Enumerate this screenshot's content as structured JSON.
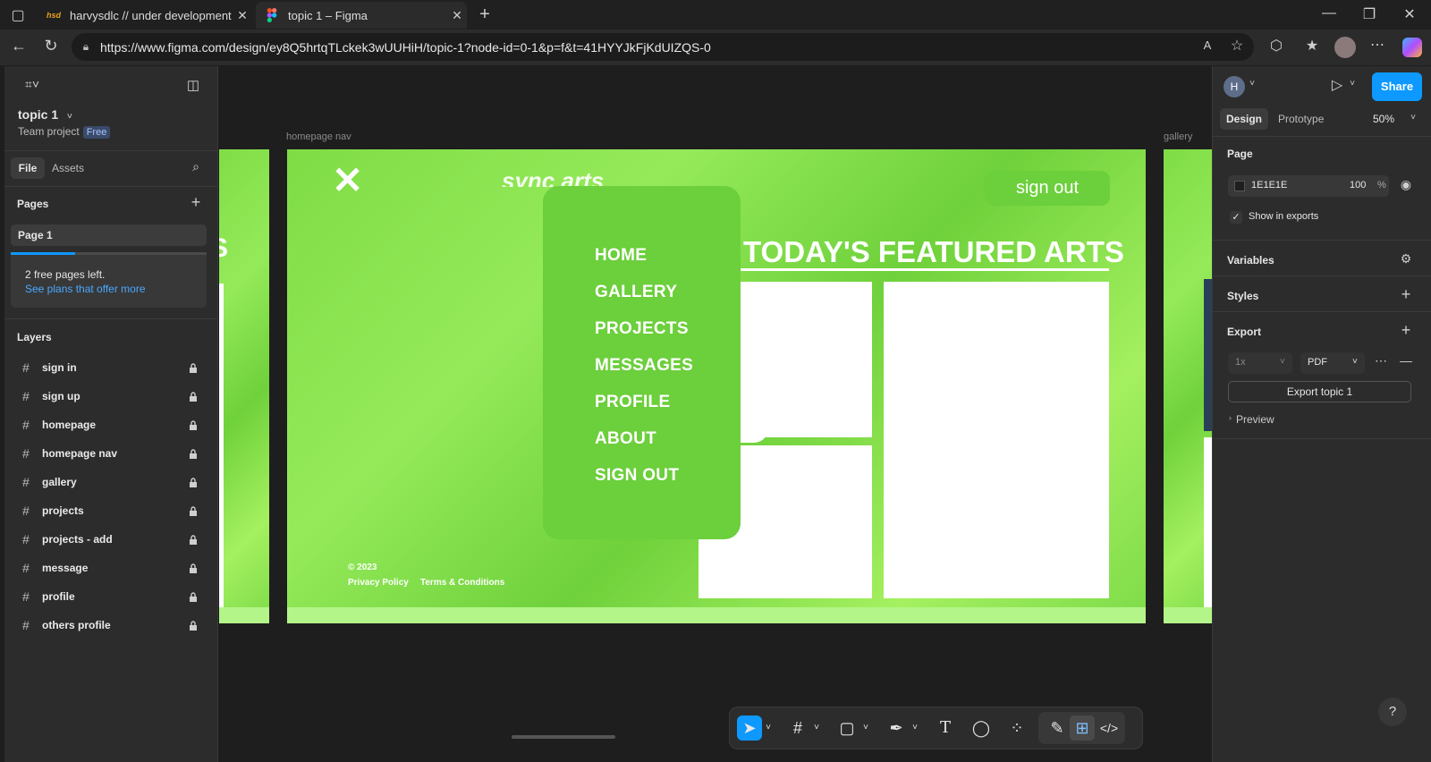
{
  "browser": {
    "tabs": [
      {
        "title": "harvysdlc // under development",
        "favicon": "hsd"
      },
      {
        "title": "topic 1 – Figma",
        "favicon": "figma-icon"
      }
    ],
    "url": "https://www.figma.com/design/ey8Q5hrtqTLckek3wUUHiH/topic-1?node-id=0-1&p=f&t=41HYYJkFjKdUIZQS-0"
  },
  "figma": {
    "file_name": "topic 1",
    "project": "Team project",
    "plan_badge": "Free",
    "tabs": {
      "file": "File",
      "assets": "Assets"
    },
    "pages_header": "Pages",
    "page": "Page 1",
    "free_pages_notice": "2 free pages left.",
    "plans_link": "See plans that offer more",
    "layers_header": "Layers",
    "layers": [
      "sign in",
      "sign up",
      "homepage",
      "homepage nav",
      "gallery",
      "projects",
      "projects - add",
      "message",
      "profile",
      "others profile"
    ]
  },
  "canvas": {
    "frame_label_main": "homepage nav",
    "frame_label_right": "gallery",
    "partial_left_text": "S",
    "logo_text": "sync arts",
    "signout_btn": "sign out",
    "featured_title": "TODAY'S FEATURED ARTS",
    "menu_items": [
      "HOME",
      "GALLERY",
      "PROJECTS",
      "MESSAGES",
      "PROFILE",
      "ABOUT",
      "SIGN OUT"
    ],
    "copyright": "© 2023",
    "privacy": "Privacy Policy",
    "terms": "Terms & Conditions"
  },
  "right_panel": {
    "avatar": "H",
    "share": "Share",
    "tab_design": "Design",
    "tab_prototype": "Prototype",
    "zoom": "50%",
    "page_header": "Page",
    "page_color": "1E1E1E",
    "page_opacity": "100",
    "percent": "%",
    "show_in_exports": "Show in exports",
    "variables": "Variables",
    "styles": "Styles",
    "export": "Export",
    "export_scale": "1x",
    "export_format": "PDF",
    "export_button": "Export topic 1",
    "preview": "Preview"
  },
  "colors": {
    "accent": "#0d99ff",
    "frame_green": "#7fdc45",
    "menu_green": "#6ccf3c"
  }
}
